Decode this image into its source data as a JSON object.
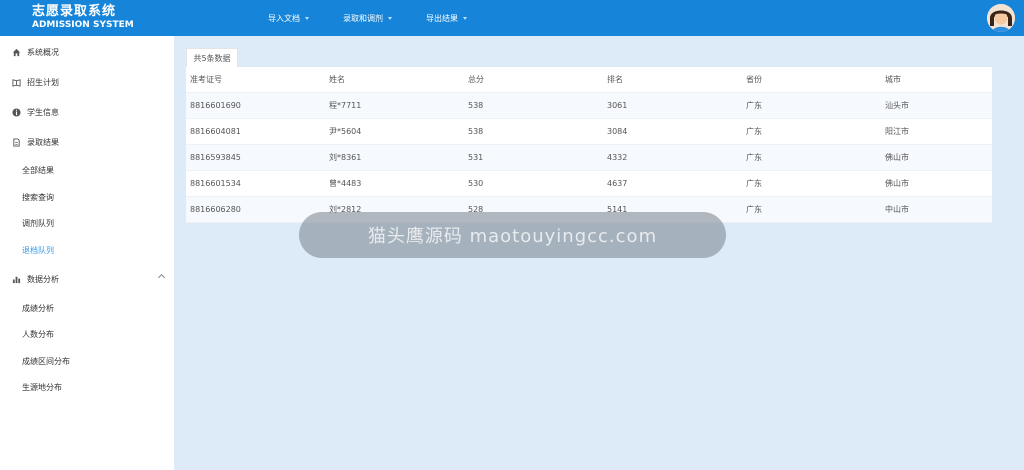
{
  "header": {
    "title_cn": "志愿录取系统",
    "title_en": "ADMISSION SYSTEM",
    "nav": [
      {
        "label": "导入文档"
      },
      {
        "label": "录取和调剂"
      },
      {
        "label": "导出结果"
      }
    ]
  },
  "sidebar": {
    "items": [
      {
        "label": "系统概况",
        "icon": "home-icon"
      },
      {
        "label": "招生计划",
        "icon": "book-icon"
      },
      {
        "label": "学生信息",
        "icon": "info-icon"
      },
      {
        "label": "录取结果",
        "icon": "document-icon"
      },
      {
        "label": "全部结果"
      },
      {
        "label": "搜索查询"
      },
      {
        "label": "调剂队列"
      },
      {
        "label": "退档队列",
        "active": true
      },
      {
        "label": "数据分析",
        "icon": "bar-chart-icon"
      },
      {
        "label": "成绩分析"
      },
      {
        "label": "人数分布"
      },
      {
        "label": "成绩区间分布"
      },
      {
        "label": "生源地分布"
      }
    ]
  },
  "content": {
    "tab_label": "共5条数据",
    "table": {
      "headers": [
        "准考证号",
        "姓名",
        "总分",
        "排名",
        "省份",
        "城市"
      ],
      "rows": [
        [
          "8816601690",
          "程*7711",
          "538",
          "3061",
          "广东",
          "汕头市"
        ],
        [
          "8816604081",
          "尹*5604",
          "538",
          "3084",
          "广东",
          "阳江市"
        ],
        [
          "8816593845",
          "刘*8361",
          "531",
          "4332",
          "广东",
          "佛山市"
        ],
        [
          "8816601534",
          "曾*4483",
          "530",
          "4637",
          "广东",
          "佛山市"
        ],
        [
          "8816606280",
          "刘*2812",
          "528",
          "5141",
          "广东",
          "中山市"
        ]
      ]
    }
  },
  "overlay": {
    "text": "猫头鹰源码 maotouyingcc.com"
  },
  "colors": {
    "header_bg": "#1584d9",
    "sidebar_bg": "#ffffff",
    "content_bg": "#dcebf7",
    "active_menu": "#3a9be6"
  }
}
